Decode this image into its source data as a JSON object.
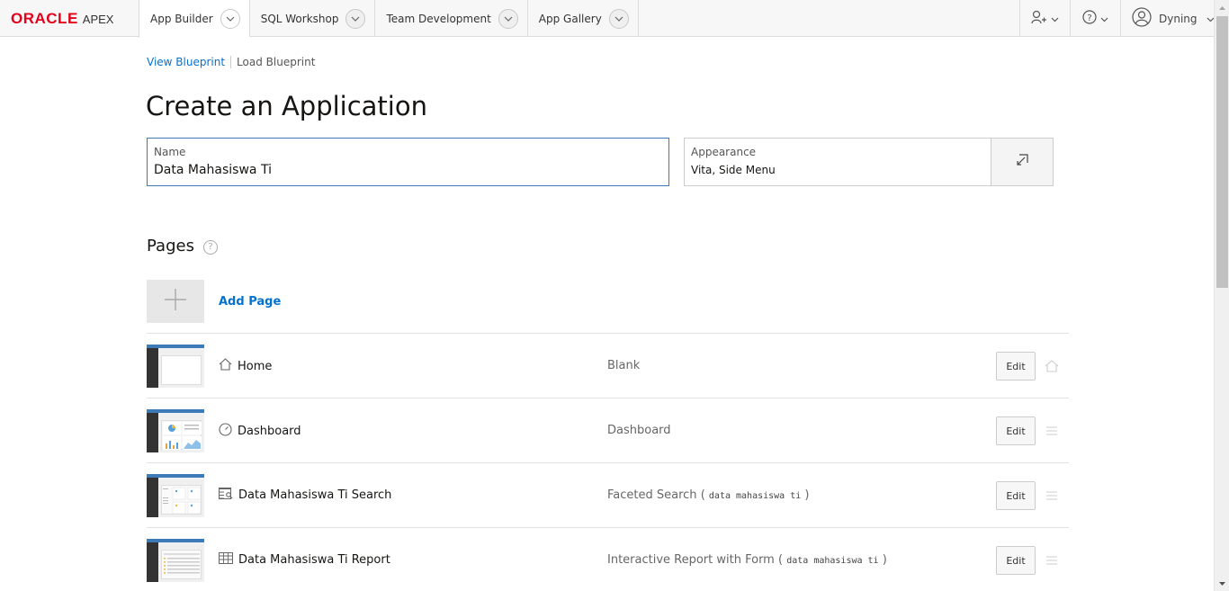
{
  "header": {
    "logo_brand": "ORACLE",
    "logo_product": "APEX",
    "nav": [
      {
        "label": "App Builder"
      },
      {
        "label": "SQL Workshop"
      },
      {
        "label": "Team Development"
      },
      {
        "label": "App Gallery"
      }
    ],
    "user_name": "Dyning"
  },
  "blueprint": {
    "view_label": "View Blueprint",
    "load_label": "Load Blueprint"
  },
  "page_title": "Create an Application",
  "name_field": {
    "label": "Name",
    "value": "Data Mahasiswa Ti"
  },
  "appearance_field": {
    "label": "Appearance",
    "value": "Vita, Side Menu"
  },
  "pages_section": {
    "heading": "Pages",
    "add_page_label": "Add Page",
    "rows": [
      {
        "name": "Home",
        "type": "Blank",
        "source": "",
        "edit_label": "Edit",
        "icon": "home-icon"
      },
      {
        "name": "Dashboard",
        "type": "Dashboard",
        "source": "",
        "edit_label": "Edit",
        "icon": "dashboard-icon"
      },
      {
        "name": "Data Mahasiswa Ti Search",
        "type": "Faceted Search",
        "source": "data mahasiswa ti",
        "edit_label": "Edit",
        "icon": "faceted-search-icon"
      },
      {
        "name": "Data Mahasiswa Ti Report",
        "type": "Interactive Report with Form",
        "source": "data mahasiswa ti",
        "edit_label": "Edit",
        "icon": "report-icon"
      }
    ]
  },
  "colors": {
    "brand_red": "#e2001a",
    "link_blue": "#0572ce",
    "focus_border": "#3f7ab8"
  }
}
